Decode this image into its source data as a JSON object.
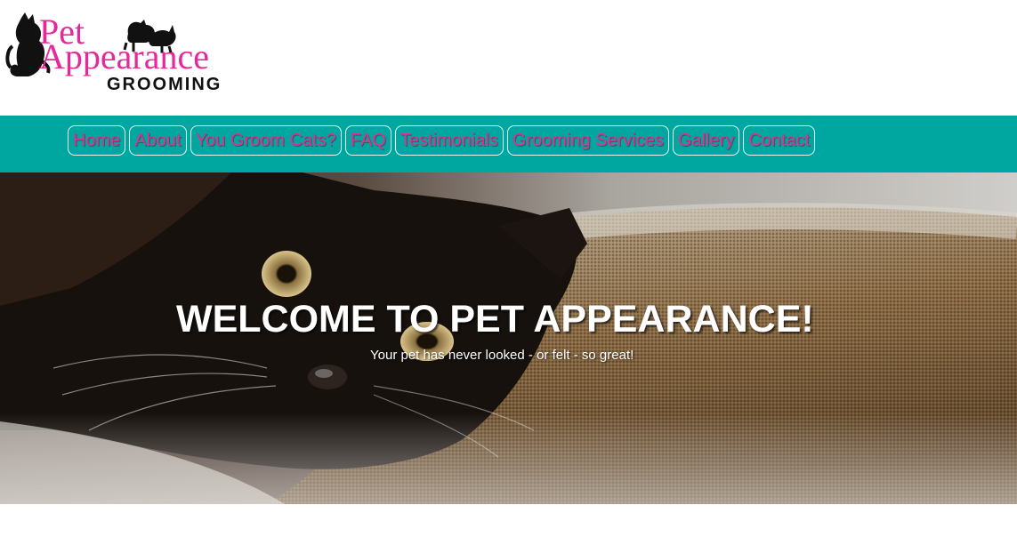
{
  "logo": {
    "line1": "Pet",
    "line2": "Appearance",
    "line3": "GROOMING",
    "color": "#e6299a"
  },
  "nav": {
    "background": "#00a6a0",
    "item_color": "#ea2b8f",
    "items": [
      {
        "label": "Home"
      },
      {
        "label": "About"
      },
      {
        "label": "You Groom Cats?"
      },
      {
        "label": "FAQ"
      },
      {
        "label": "Testimonials"
      },
      {
        "label": "Grooming Services"
      },
      {
        "label": "Gallery"
      },
      {
        "label": "Contact"
      }
    ]
  },
  "hero": {
    "title": "WELCOME TO PET APPEARANCE!",
    "subtitle": "Your pet has never looked - or felt - so great!",
    "image_subject": "black-cat-on-couch"
  }
}
